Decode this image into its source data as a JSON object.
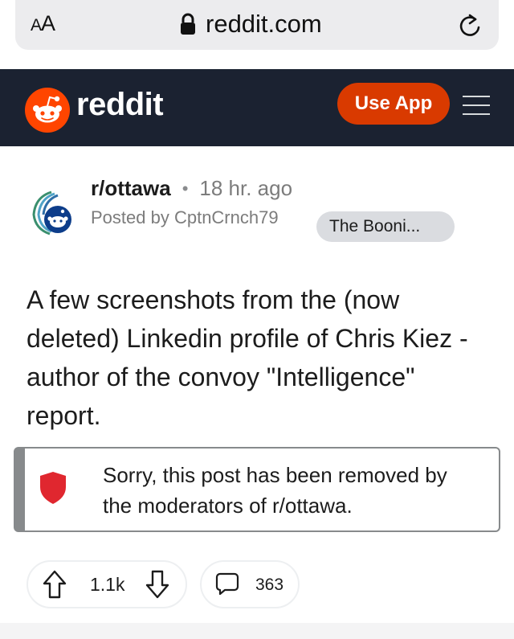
{
  "browser": {
    "aa_label_big": "A",
    "aa_label_small": "A",
    "url": "reddit.com"
  },
  "header": {
    "wordmark": "reddit",
    "use_app_label": "Use App",
    "brand_color": "#ff4500",
    "bg_color": "#1b2231"
  },
  "post": {
    "subreddit": "r/ottawa",
    "separator": "•",
    "time": "18 hr. ago",
    "posted_by": "Posted by CptnCrnch79",
    "flair": "The Booni...",
    "title": "A few screenshots from the (now deleted) Linkedin profile of Chris Kiez - author of the convoy \"Intelligence\" report."
  },
  "removed_notice": {
    "text": "Sorry, this post has been removed by the moderators of r/ottawa.",
    "icon": "shield-icon",
    "icon_color": "#e0272f"
  },
  "actions": {
    "score": "1.1k",
    "comments": "363"
  }
}
